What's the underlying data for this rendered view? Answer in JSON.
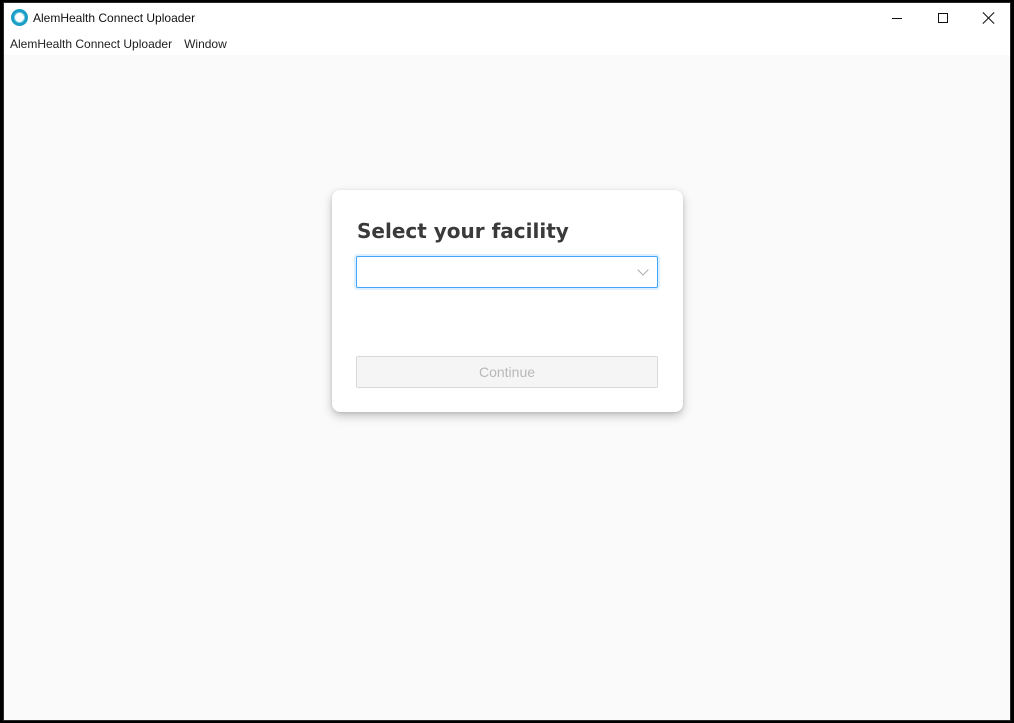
{
  "window": {
    "title": "AlemHealth Connect Uploader",
    "controls": {
      "minimize": "minimize-icon",
      "maximize": "maximize-icon",
      "close": "close-icon"
    }
  },
  "menubar": {
    "items": [
      {
        "label": "AlemHealth Connect Uploader"
      },
      {
        "label": "Window"
      }
    ]
  },
  "facility_form": {
    "heading": "Select your facility",
    "facility_select": {
      "value": "",
      "placeholder": ""
    },
    "continue_label": "Continue",
    "continue_disabled": true
  },
  "colors": {
    "accent": "#40a9ff",
    "brand": "#1a9ec7",
    "disabled_text": "#b8b8b8"
  }
}
